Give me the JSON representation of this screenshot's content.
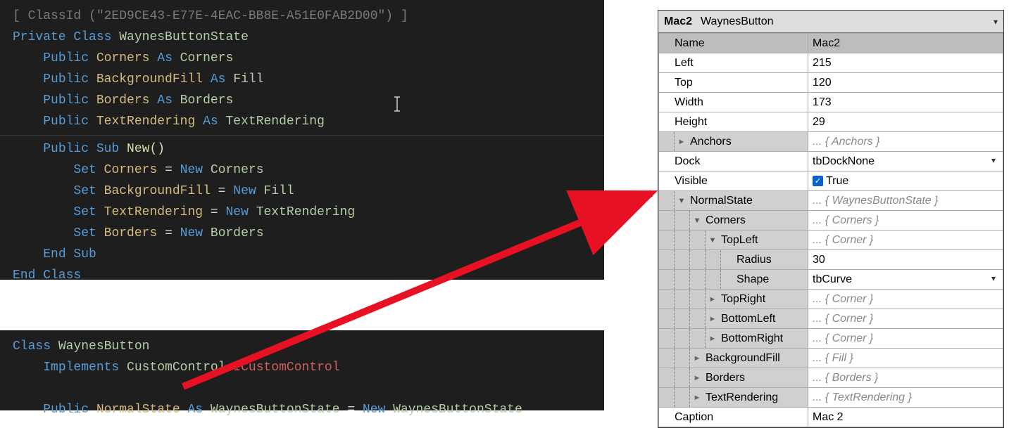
{
  "code1": {
    "attr_open": "[ ",
    "attr_fn": "ClassId ",
    "attr_args": "(\"2ED9CE43-E77E-4EAC-BB8E-A51E0FAB2D00\") ]",
    "l1_kw": "Private Class ",
    "l1_cls": "WaynesButtonState",
    "l2_kw": "Public ",
    "l2_id": "Corners ",
    "l2_as": "As ",
    "l2_ty": "Corners",
    "l3_kw": "Public ",
    "l3_id": "BackgroundFill ",
    "l3_as": "As ",
    "l3_ty": "Fill",
    "l4_kw": "Public ",
    "l4_id": "Borders ",
    "l4_as": "As ",
    "l4_ty": "Borders",
    "l5_kw": "Public ",
    "l5_id": "TextRendering ",
    "l5_as": "As ",
    "l5_ty": "TextRendering",
    "l6_kw": "Public Sub ",
    "l6_fn": "New()",
    "l7_set": "Set ",
    "l7_id": "Corners ",
    "l7_eq": "= ",
    "l7_new": "New ",
    "l7_ty": "Corners",
    "l8_set": "Set ",
    "l8_id": "BackgroundFill ",
    "l8_eq": "= ",
    "l8_new": "New ",
    "l8_ty": "Fill",
    "l9_set": "Set ",
    "l9_id": "TextRendering ",
    "l9_eq": "= ",
    "l9_new": "New ",
    "l9_ty": "TextRendering",
    "l10_set": "Set ",
    "l10_id": "Borders ",
    "l10_eq": "= ",
    "l10_new": "New ",
    "l10_ty": "Borders",
    "l11": "End Sub",
    "l12": "End Class"
  },
  "code2": {
    "l1_kw": "Class ",
    "l1_cls": "WaynesButton",
    "l2_kw": "Implements ",
    "l2_a": "CustomControl",
    "l2_dot": ".",
    "l2_b": "ICustomControl",
    "l3_kw": "Public ",
    "l3_id": "NormalState ",
    "l3_as": "As ",
    "l3_ty": "WaynesButtonState ",
    "l3_eq": "= ",
    "l3_new": "New ",
    "l3_ty2": "WaynesButtonState"
  },
  "header": {
    "obj": "Mac2",
    "type": "WaynesButton"
  },
  "rows": [
    {
      "k": "Name",
      "v": "Mac2",
      "depth": 0,
      "tri": "",
      "sel": true
    },
    {
      "k": "Left",
      "v": "215",
      "depth": 0,
      "tri": ""
    },
    {
      "k": "Top",
      "v": "120",
      "depth": 0,
      "tri": ""
    },
    {
      "k": "Width",
      "v": "173",
      "depth": 0,
      "tri": ""
    },
    {
      "k": "Height",
      "v": "29",
      "depth": 0,
      "tri": ""
    },
    {
      "k": "Anchors",
      "v": "... { Anchors }",
      "depth": 1,
      "tri": "►",
      "ph": true,
      "sub": true
    },
    {
      "k": "Dock",
      "v": "tbDockNone",
      "depth": 0,
      "tri": "",
      "drop": true
    },
    {
      "k": "Visible",
      "v": "True",
      "depth": 0,
      "tri": "",
      "chk": true
    },
    {
      "k": "NormalState",
      "v": "... { WaynesButtonState }",
      "depth": 1,
      "tri": "▼",
      "ph": true,
      "sub": true
    },
    {
      "k": "Corners",
      "v": "... { Corners }",
      "depth": 2,
      "tri": "▼",
      "ph": true,
      "sub": true
    },
    {
      "k": "TopLeft",
      "v": "... { Corner }",
      "depth": 3,
      "tri": "▼",
      "ph": true,
      "sub": true
    },
    {
      "k": "Radius",
      "v": "30",
      "depth": 4,
      "tri": "",
      "sub": true
    },
    {
      "k": "Shape",
      "v": "tbCurve",
      "depth": 4,
      "tri": "",
      "drop": true,
      "sub": true
    },
    {
      "k": "TopRight",
      "v": "... { Corner }",
      "depth": 3,
      "tri": "►",
      "ph": true,
      "sub": true
    },
    {
      "k": "BottomLeft",
      "v": "... { Corner }",
      "depth": 3,
      "tri": "►",
      "ph": true,
      "sub": true
    },
    {
      "k": "BottomRight",
      "v": "... { Corner }",
      "depth": 3,
      "tri": "►",
      "ph": true,
      "sub": true
    },
    {
      "k": "BackgroundFill",
      "v": "... { Fill }",
      "depth": 2,
      "tri": "►",
      "ph": true,
      "sub": true
    },
    {
      "k": "Borders",
      "v": "... { Borders }",
      "depth": 2,
      "tri": "►",
      "ph": true,
      "sub": true
    },
    {
      "k": "TextRendering",
      "v": "... { TextRendering }",
      "depth": 2,
      "tri": "►",
      "ph": true,
      "sub": true
    },
    {
      "k": "Caption",
      "v": "Mac 2",
      "depth": 0,
      "tri": ""
    }
  ]
}
